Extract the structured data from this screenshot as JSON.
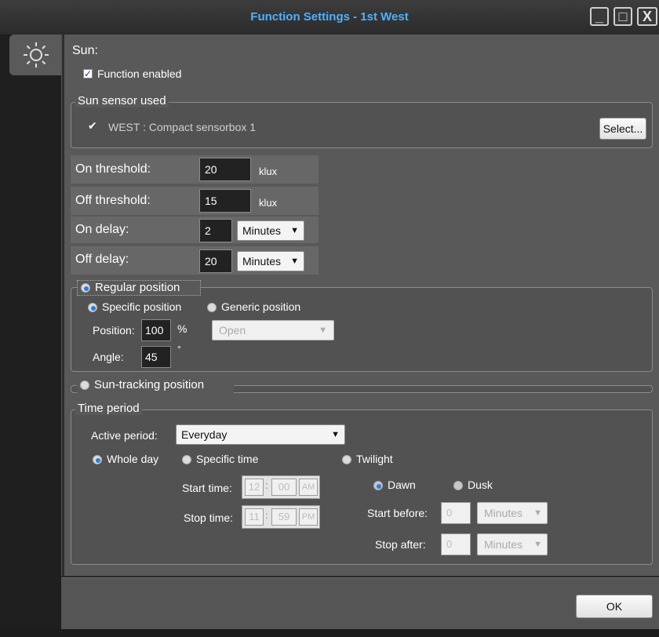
{
  "window": {
    "title": "Function Settings - 1st West",
    "minimize": "_",
    "maximize": "□",
    "close": "X"
  },
  "sidebar": {
    "tab_icon": "sun-icon"
  },
  "sun": {
    "heading": "Sun:",
    "function_enabled_label": "Function enabled",
    "function_enabled": true
  },
  "sensor_group": {
    "title": "Sun sensor used",
    "sensor_name": "WEST : Compact sensorbox 1",
    "sensor_checked": true,
    "select_button": "Select..."
  },
  "thresholds": {
    "on_label": "On threshold:",
    "on_value": "20",
    "on_unit": "klux",
    "off_label": "Off threshold:",
    "off_value": "15",
    "off_unit": "klux",
    "on_delay_label": "On delay:",
    "on_delay_value": "2",
    "on_delay_unit": "Minutes",
    "off_delay_label": "Off delay:",
    "off_delay_value": "20",
    "off_delay_unit": "Minutes"
  },
  "regular_position": {
    "title": "Regular position",
    "specific_label": "Specific position",
    "generic_label": "Generic position",
    "position_label": "Position:",
    "position_value": "100",
    "position_unit": "%",
    "generic_select": "Open",
    "angle_label": "Angle:",
    "angle_value": "45",
    "angle_unit": "°"
  },
  "sun_tracking": {
    "title": "Sun-tracking position"
  },
  "time_period": {
    "title": "Time period",
    "active_period_label": "Active period:",
    "active_period_value": "Everyday",
    "whole_day_label": "Whole day",
    "specific_time_label": "Specific time",
    "twilight_label": "Twilight",
    "start_time_label": "Start time:",
    "start_hour": "12",
    "start_min": "00",
    "start_ampm": "AM",
    "stop_time_label": "Stop time:",
    "stop_hour": "11",
    "stop_min": "59",
    "stop_ampm": "PM",
    "time_sep": ":",
    "dawn_label": "Dawn",
    "dusk_label": "Dusk",
    "start_before_label": "Start before:",
    "start_before_value": "0",
    "start_before_unit": "Minutes",
    "stop_after_label": "Stop after:",
    "stop_after_value": "0",
    "stop_after_unit": "Minutes"
  },
  "footer": {
    "ok_button": "OK"
  },
  "colors": {
    "title_accent": "#4fb0ff",
    "radio_selected": "#2b7de0"
  }
}
